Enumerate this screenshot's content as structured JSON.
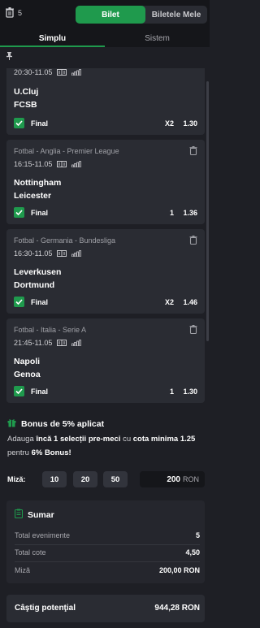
{
  "header": {
    "trash_count": "5",
    "segments": {
      "active": "Bilet",
      "other": "Biletele Mele"
    }
  },
  "tabs": {
    "simplu": "Simplu",
    "sistem": "Sistem"
  },
  "bets": [
    {
      "league": "",
      "time": "20:30-11.05",
      "home": "U.Cluj",
      "away": "FCSB",
      "market": "Final",
      "pick": "X2",
      "odd": "1.30"
    },
    {
      "league": "Fotbal - Anglia - Premier League",
      "time": "16:15-11.05",
      "home": "Nottingham",
      "away": "Leicester",
      "market": "Final",
      "pick": "1",
      "odd": "1.36"
    },
    {
      "league": "Fotbal - Germania - Bundesliga",
      "time": "16:30-11.05",
      "home": "Leverkusen",
      "away": "Dortmund",
      "market": "Final",
      "pick": "X2",
      "odd": "1.46"
    },
    {
      "league": "Fotbal - Italia - Serie A",
      "time": "21:45-11.05",
      "home": "Napoli",
      "away": "Genoa",
      "market": "Final",
      "pick": "1",
      "odd": "1.30"
    }
  ],
  "bonus": {
    "title": "Bonus de 5% aplicat",
    "t1": "Adauga ",
    "t2": "încă 1 selecții pre-meci",
    "t3": " cu ",
    "t4": "cota minima 1.25",
    "t5": " pentru ",
    "t6": "6% Bonus!"
  },
  "stake": {
    "label": "Miză:",
    "chips": [
      "10",
      "20",
      "50"
    ],
    "value": "200",
    "currency": "RON"
  },
  "summary": {
    "title": "Sumar",
    "rows": [
      {
        "label": "Total evenimente",
        "value": "5"
      },
      {
        "label": "Total cote",
        "value": "4,50"
      },
      {
        "label": "Miză",
        "value": "200,00 RON"
      }
    ]
  },
  "potential": {
    "label": "Câştig potenţial",
    "value": "944,28 RON"
  },
  "colors": {
    "accent": "#1f9a4d",
    "background": "#1e1f25",
    "card": "#2a2c33"
  }
}
